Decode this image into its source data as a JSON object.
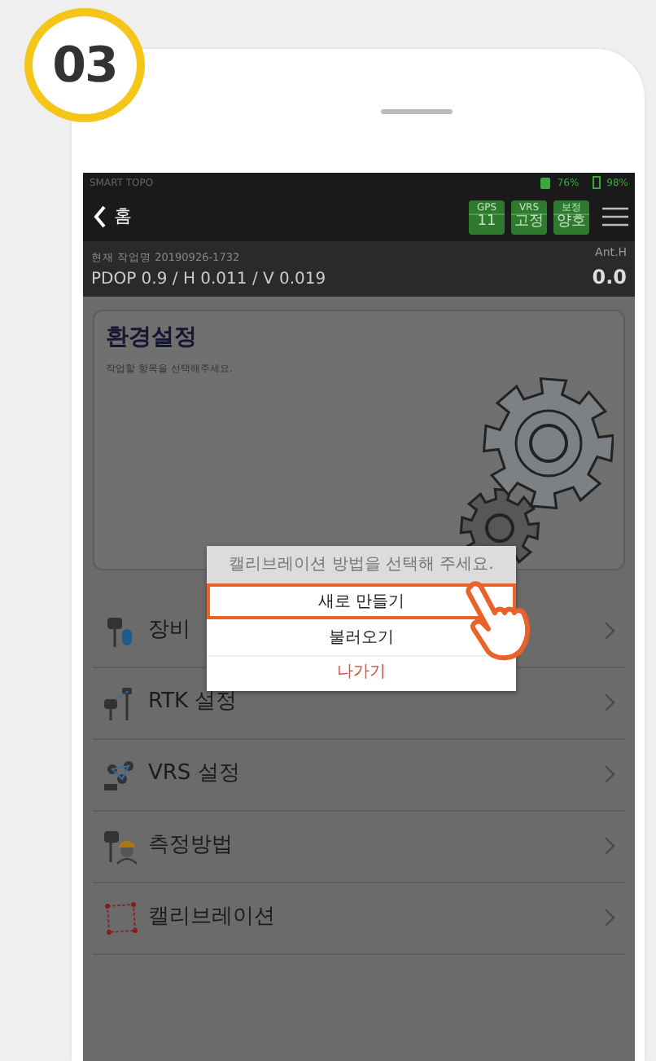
{
  "step_badge": "03",
  "status_bar": {
    "app_name": "SMART TOPO",
    "signal": "76%",
    "battery": "98%"
  },
  "header": {
    "back_label": "홈",
    "indicators": [
      {
        "label": "GPS",
        "value": "11"
      },
      {
        "label": "VRS",
        "value": "고정"
      },
      {
        "label": "보정",
        "value": "양호"
      }
    ]
  },
  "info": {
    "job": "현재 작업명 20190926-1732",
    "precision": "PDOP 0.9 / H 0.011 / V 0.019",
    "ant_label": "Ant.H",
    "ant_value": "0.0"
  },
  "settings_card": {
    "title": "환경설정",
    "subtitle": "작업할 항목을 선택해주세요."
  },
  "menu": [
    {
      "kind": "device",
      "label": "장비"
    },
    {
      "kind": "rtk",
      "label": "RTK 설정"
    },
    {
      "kind": "vrs",
      "label": "VRS 설정"
    },
    {
      "kind": "survey",
      "label": "측정방법"
    },
    {
      "kind": "calibration",
      "label": "캘리브레이션"
    }
  ],
  "dialog": {
    "title": "캘리브레이션 방법을 선택해 주세요.",
    "options": [
      {
        "label": "새로 만들기",
        "selected": true,
        "kind": "normal"
      },
      {
        "label": "불러오기",
        "selected": false,
        "kind": "normal"
      },
      {
        "label": "나가기",
        "selected": false,
        "kind": "danger"
      }
    ]
  }
}
